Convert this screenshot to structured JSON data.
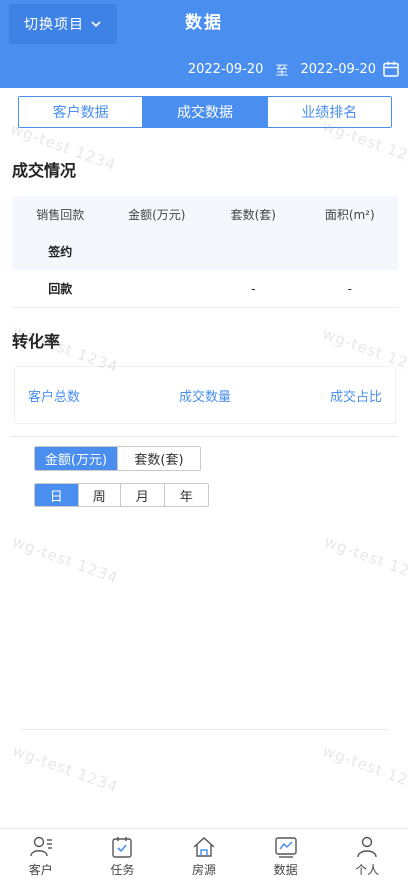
{
  "header": {
    "switch_label": "切换项目",
    "title": "数据",
    "date_start": "2022-09-20",
    "date_sep": "至",
    "date_end": "2022-09-20"
  },
  "tabs": [
    {
      "label": "客户数据",
      "active": false
    },
    {
      "label": "成交数据",
      "active": true
    },
    {
      "label": "业绩排名",
      "active": false
    }
  ],
  "deal": {
    "title": "成交情况",
    "columns": [
      "销售回款",
      "金额(万元)",
      "套数(套)",
      "面积(m²)"
    ],
    "rows": [
      {
        "label": "签约",
        "amount": "",
        "count": "",
        "area": ""
      },
      {
        "label": "回款",
        "amount": "",
        "count": "-",
        "area": "-"
      }
    ]
  },
  "conversion": {
    "title": "转化率",
    "items": [
      "客户总数",
      "成交数量",
      "成交占比"
    ]
  },
  "metric_toggle": {
    "options": [
      "金额(万元)",
      "套数(套)"
    ],
    "selected": "金额(万元)"
  },
  "period_toggle": {
    "options": [
      "日",
      "周",
      "月",
      "年"
    ],
    "selected": "日"
  },
  "watermark": "wg-test 1234",
  "nav": [
    {
      "label": "客户",
      "icon": "customer-icon"
    },
    {
      "label": "任务",
      "icon": "task-icon"
    },
    {
      "label": "房源",
      "icon": "house-icon"
    },
    {
      "label": "数据",
      "icon": "chart-icon"
    },
    {
      "label": "个人",
      "icon": "person-icon"
    }
  ],
  "colors": {
    "accent": "#4a8ff0"
  }
}
